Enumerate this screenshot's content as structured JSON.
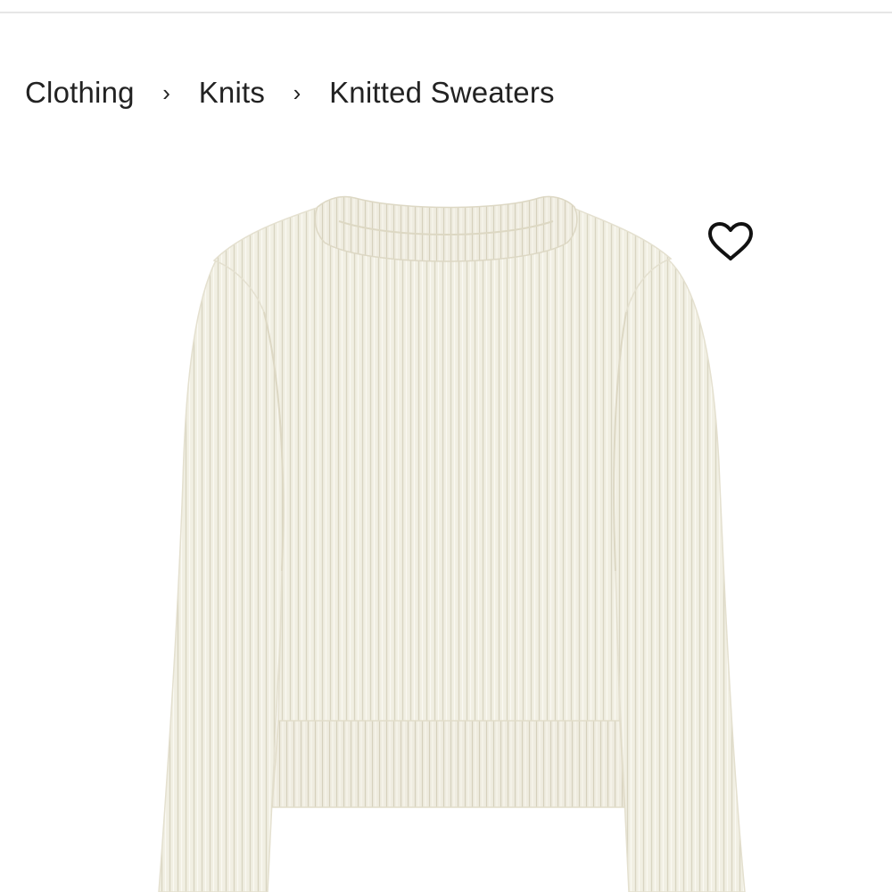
{
  "breadcrumb": {
    "items": [
      "Clothing",
      "Knits",
      "Knitted Sweaters"
    ],
    "separator": "›"
  },
  "product": {
    "image_icon": "ribbed-knit-sweater-image",
    "color": "#f1efe3"
  },
  "wishlist": {
    "icon": "heart-outline-icon"
  }
}
